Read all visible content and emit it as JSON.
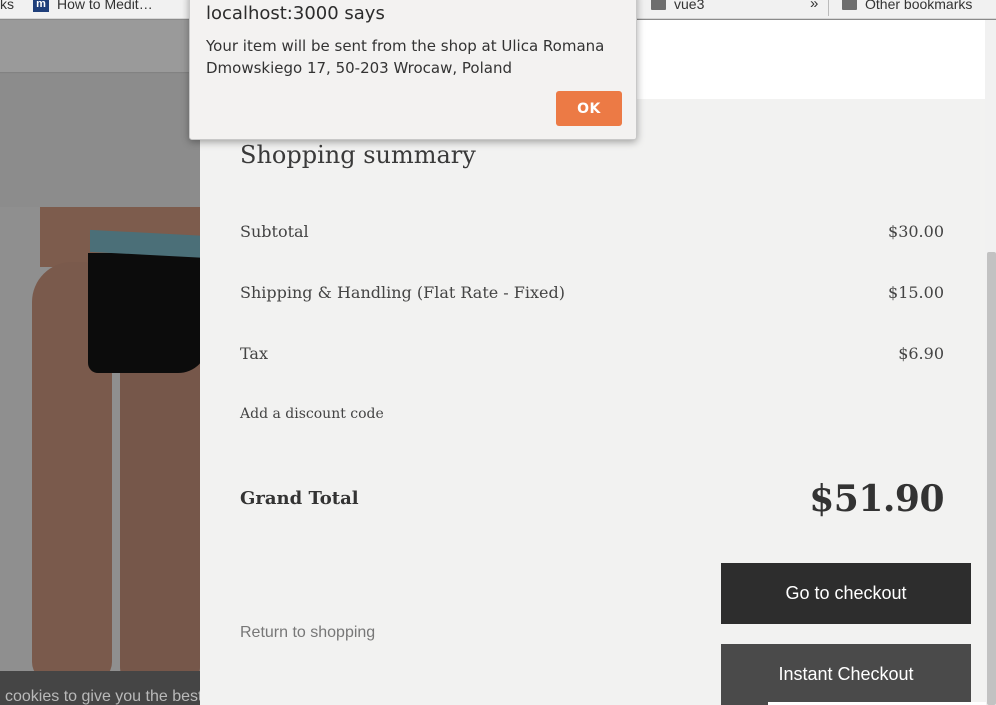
{
  "bookmarks_bar": {
    "items": [
      {
        "label": "ks",
        "icon": "none"
      },
      {
        "label": "How to Medit…",
        "icon": "medium-favicon"
      },
      {
        "label": "vue3",
        "icon": "folder-icon"
      }
    ],
    "overflow": "»",
    "other": {
      "label": "Other bookmarks",
      "icon": "folder-icon"
    }
  },
  "backdrop": {
    "cookie_text": "cookies to give you the best"
  },
  "alert": {
    "title": "localhost:3000 says",
    "message": "Your item will be sent from the shop at Ulica Romana Dmowskiego 17, 50-203 Wrocaw, Poland",
    "ok_label": "OK",
    "ok_color": "#ec7a45"
  },
  "summary": {
    "title": "Shopping summary",
    "rows": [
      {
        "label": "Subtotal",
        "value": "$30.00"
      },
      {
        "label": "Shipping & Handling (Flat Rate - Fixed)",
        "value": "$15.00"
      },
      {
        "label": "Tax",
        "value": "$6.90"
      }
    ],
    "discount_label": "Add a discount code",
    "grand_total_label": "Grand Total",
    "grand_total_value": "$51.90",
    "checkout_label": "Go to checkout",
    "instant_checkout_label": "Instant Checkout",
    "return_label": "Return to shopping"
  }
}
